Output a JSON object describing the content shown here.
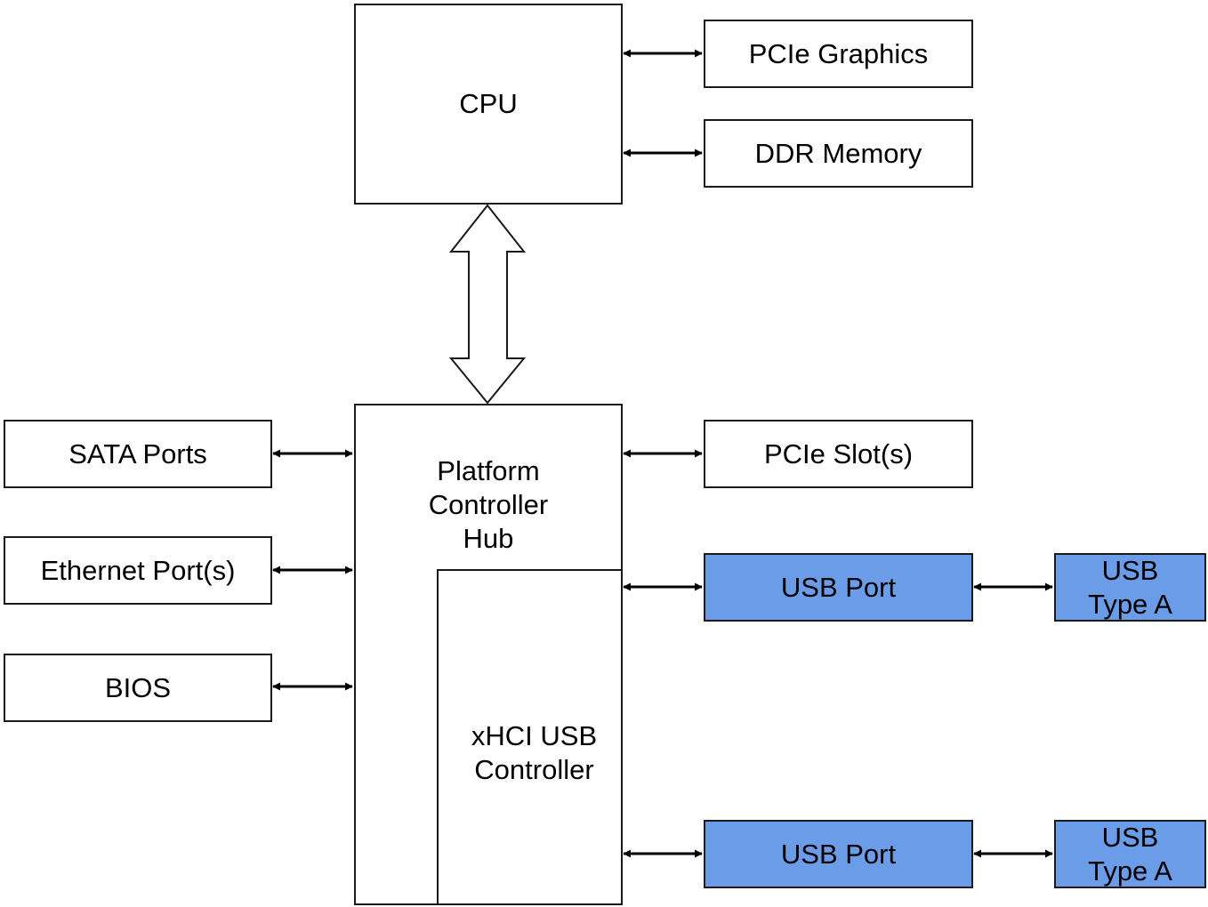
{
  "diagram": {
    "colors": {
      "usb_fill": "#6a9ce8",
      "stroke": "#1a1a1a",
      "background": "#ffffff"
    },
    "nodes": {
      "cpu": {
        "label": "CPU"
      },
      "pcie_graphics": {
        "label": "PCIe Graphics"
      },
      "ddr_memory": {
        "label": "DDR Memory"
      },
      "pch": {
        "label": "Platform\nController\nHub"
      },
      "xhci": {
        "label": "xHCI USB\nController"
      },
      "sata": {
        "label": "SATA Ports"
      },
      "ethernet": {
        "label": "Ethernet Port(s)"
      },
      "bios": {
        "label": "BIOS"
      },
      "pcie_slots": {
        "label": "PCIe Slot(s)"
      },
      "usb_port_1": {
        "label": "USB Port"
      },
      "usb_type_a_1": {
        "label": "USB\nType A"
      },
      "usb_port_2": {
        "label": "USB Port"
      },
      "usb_type_a_2": {
        "label": "USB\nType A"
      }
    },
    "edges": [
      {
        "from": "cpu",
        "to": "pcie_graphics",
        "type": "bidirectional"
      },
      {
        "from": "cpu",
        "to": "ddr_memory",
        "type": "bidirectional"
      },
      {
        "from": "cpu",
        "to": "pch",
        "type": "bidirectional-bus"
      },
      {
        "from": "sata",
        "to": "pch",
        "type": "bidirectional"
      },
      {
        "from": "ethernet",
        "to": "pch",
        "type": "bidirectional"
      },
      {
        "from": "bios",
        "to": "pch",
        "type": "bidirectional"
      },
      {
        "from": "pch",
        "to": "pcie_slots",
        "type": "bidirectional"
      },
      {
        "from": "xhci",
        "to": "usb_port_1",
        "type": "bidirectional"
      },
      {
        "from": "usb_port_1",
        "to": "usb_type_a_1",
        "type": "bidirectional"
      },
      {
        "from": "xhci",
        "to": "usb_port_2",
        "type": "bidirectional"
      },
      {
        "from": "usb_port_2",
        "to": "usb_type_a_2",
        "type": "bidirectional"
      }
    ]
  }
}
